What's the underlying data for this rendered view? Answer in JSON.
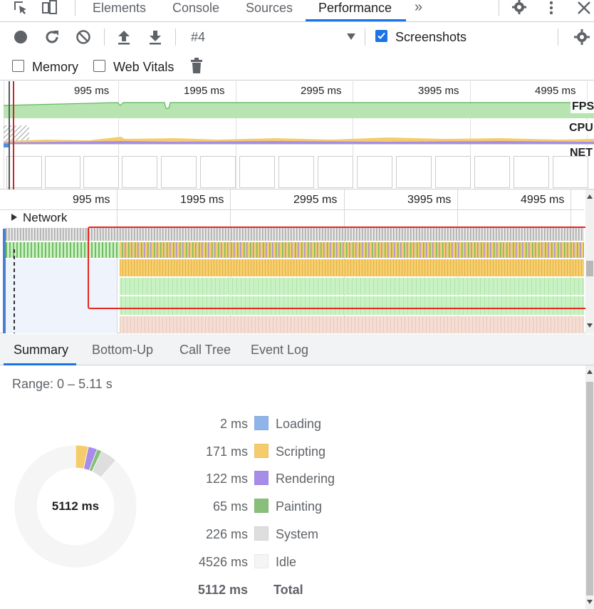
{
  "devtools": {
    "tabs": [
      "Elements",
      "Console",
      "Sources",
      "Performance"
    ],
    "overflow": "»",
    "icons": [
      "inspect-element-icon",
      "device-toolbar-icon",
      "settings-gear-icon",
      "more-vert-icon",
      "close-icon"
    ],
    "active_tab": "Performance"
  },
  "toolbar": {
    "recording_select": "#4",
    "screenshots_label": "Screenshots",
    "screenshots_checked": true,
    "icons": [
      "record-icon",
      "reload-icon",
      "clear-icon",
      "upload-icon",
      "download-icon",
      "dropdown-arrow-icon",
      "capture-settings-gear-icon"
    ]
  },
  "options": {
    "memory_label": "Memory",
    "memory_checked": false,
    "webvitals_label": "Web Vitals",
    "webvitals_checked": false,
    "icons": [
      "trash-icon"
    ]
  },
  "overview": {
    "ticks": [
      "995 ms",
      "1995 ms",
      "2995 ms",
      "3995 ms",
      "4995 ms"
    ],
    "lanes": [
      "FPS",
      "CPU",
      "NET"
    ]
  },
  "flame": {
    "ticks": [
      "995 ms",
      "1995 ms",
      "2995 ms",
      "3995 ms",
      "4995 ms"
    ],
    "network_label": "Network",
    "highlight_color": "#e8261d"
  },
  "bottom_tabs": [
    "Summary",
    "Bottom-Up",
    "Call Tree",
    "Event Log"
  ],
  "summary": {
    "range": "Range: 0 – 5.11 s",
    "rows": [
      {
        "value": "2 ms",
        "label": "Loading",
        "color": "#8fb4e8",
        "ms": 2
      },
      {
        "value": "171 ms",
        "label": "Scripting",
        "color": "#f5cc6b",
        "ms": 171
      },
      {
        "value": "122 ms",
        "label": "Rendering",
        "color": "#a88de8",
        "ms": 122
      },
      {
        "value": "65 ms",
        "label": "Painting",
        "color": "#88c07a",
        "ms": 65
      },
      {
        "value": "226 ms",
        "label": "System",
        "color": "#dedede",
        "ms": 226
      },
      {
        "value": "4526 ms",
        "label": "Idle",
        "color": "#f5f5f5",
        "ms": 4526
      }
    ],
    "total_value": "5112 ms",
    "total_label": "Total",
    "pie_center": "5112 ms"
  }
}
